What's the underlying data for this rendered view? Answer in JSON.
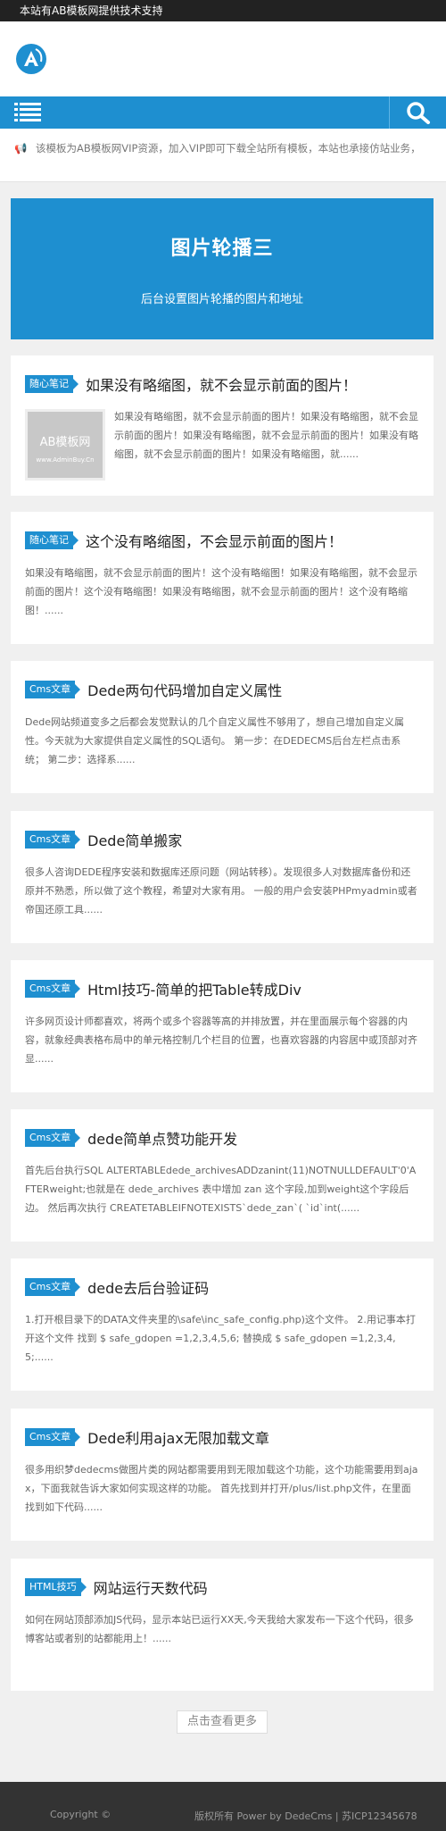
{
  "topbar": {
    "text": "本站有AB模板网提供技术支持"
  },
  "header": {
    "logo_letter": "A"
  },
  "nav": {
    "menu_icon": "menu-icon",
    "search_icon": "search-icon"
  },
  "notice": {
    "icon": "bell-icon",
    "text": "该模板为AB模板网VIP资源，加入VIP即可下载全站所有模板，本站也承接仿站业务，"
  },
  "banner": {
    "title": "图片轮播三",
    "subtitle": "后台设置图片轮播的图片和地址"
  },
  "articles": [
    {
      "tag": "随心笔记",
      "title": "如果没有略缩图，就不会显示前面的图片！",
      "thumb_text": "AB模板网",
      "thumb_sub": "www.AdminBuy.Cn",
      "excerpt": "如果没有略缩图，就不会显示前面的图片！如果没有略缩图，就不会显示前面的图片！如果没有略缩图，就不会显示前面的图片！如果没有略缩图，就不会显示前面的图片！如果没有略缩图，就......"
    },
    {
      "tag": "随心笔记",
      "title": "这个没有略缩图，不会显示前面的图片！",
      "excerpt": "如果没有略缩图，就不会显示前面的图片！这个没有略缩图！如果没有略缩图，就不会显示前面的图片！这个没有略缩图！如果没有略缩图，就不会显示前面的图片！这个没有略缩图！......"
    },
    {
      "tag": "Cms文章",
      "title": "Dede两句代码增加自定义属性",
      "excerpt": "Dede网站频道变多之后都会发觉默认的几个自定义属性不够用了，想自己增加自定义属性。今天就为大家提供自定义属性的SQL语句。 第一步：在DEDECMS后台左栏点击系统； 第二步：选择系......"
    },
    {
      "tag": "Cms文章",
      "title": "Dede简单搬家",
      "excerpt": "很多人咨询DEDE程序安装和数据库还原问题（网站转移）。发现很多人对数据库备份和还原并不熟悉，所以做了这个教程，希望对大家有用。 一般的用户会安装PHPmyadmin或者帝国还原工具......"
    },
    {
      "tag": "Cms文章",
      "title": "Html技巧-简单的把Table转成Div",
      "excerpt": "许多网页设计师都喜欢，将两个或多个容器等高的并排放置，并在里面展示每个容器的内容，就象经典表格布局中的单元格控制几个栏目的位置，也喜欢容器的内容居中或顶部对齐显......"
    },
    {
      "tag": "Cms文章",
      "title": "dede简单点赞功能开发",
      "excerpt": "首先后台执行SQL ALTERTABLEdede_archivesADDzanint(11)NOTNULLDEFAULT'0'AFTERweight;也就是在 dede_archives 表中增加 zan 这个字段,加到weight这个字段后边。 然后再次执行 CREATETABLEIFNOTEXISTS`dede_zan`( `id`int(......"
    },
    {
      "tag": "Cms文章",
      "title": "dede去后台验证码",
      "excerpt": "1.打开根目录下的DATA文件夹里的\\safe\\inc_safe_config.php)这个文件。 2.用记事本打开这个文件 找到 $ safe_gdopen =1,2,3,4,5,6; 替换成 $ safe_gdopen =1,2,3,4,5;......"
    },
    {
      "tag": "Cms文章",
      "title": "Dede利用ajax无限加载文章",
      "excerpt": "很多用织梦dedecms做图片类的网站都需要用到无限加载这个功能，这个功能需要用到ajax，下面我就告诉大家如何实现这样的功能。 首先找到并打开/plus/list.php文件，在里面找到如下代码......"
    },
    {
      "tag": "HTML技巧",
      "title": "网站运行天数代码",
      "excerpt": "如何在网站顶部添加JS代码，显示本站已运行XX天,今天我给大家发布一下这个代码，很多博客站或者别的站都能用上！......"
    }
  ],
  "more_label": "点击查看更多",
  "footer": {
    "copyright": "Copyright ©",
    "right": "版权所有 Power by DedeCms | 苏ICP12345678"
  }
}
